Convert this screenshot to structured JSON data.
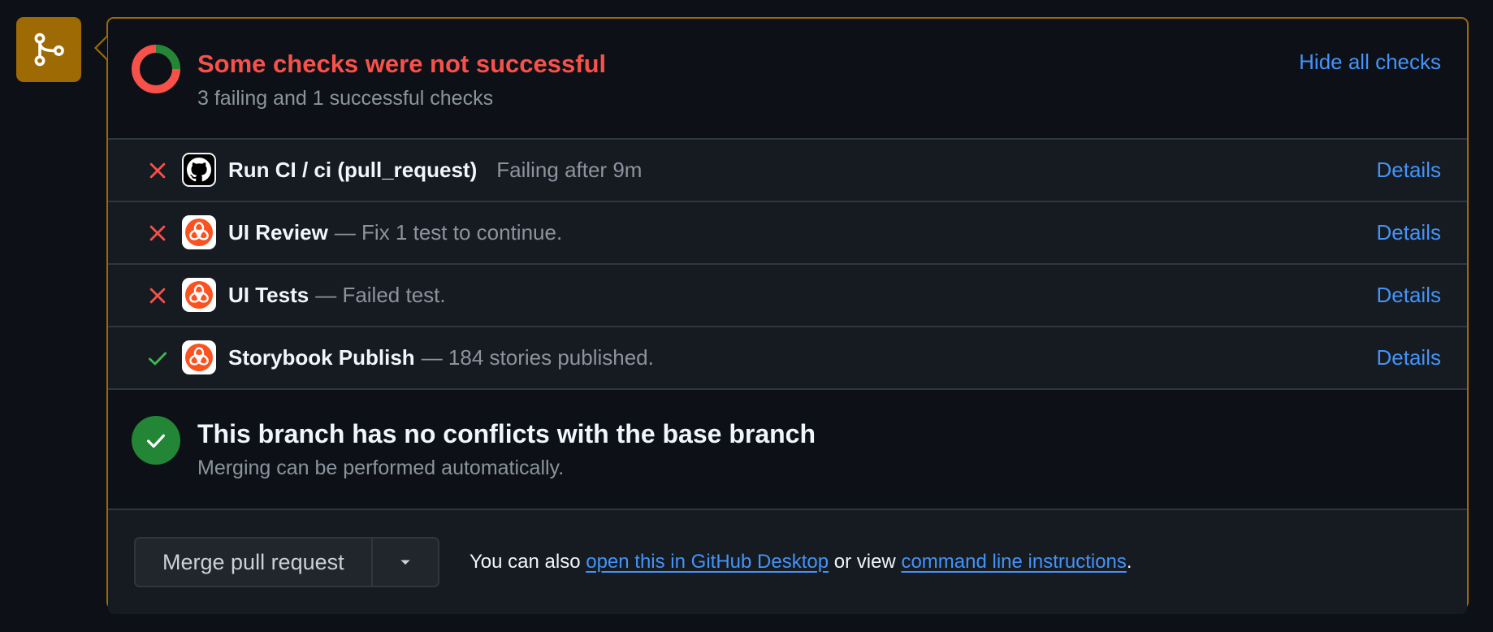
{
  "summary": {
    "title": "Some checks were not successful",
    "subtitle": "3 failing and 1 successful checks",
    "hide_link": "Hide all checks",
    "failing_count": 3,
    "successful_count": 1
  },
  "checks": [
    {
      "status": "failed",
      "icon": "github-icon",
      "name": "Run CI / ci (pull_request)",
      "description": "Failing after 9m",
      "details": "Details"
    },
    {
      "status": "failed",
      "icon": "chromatic-icon",
      "name": "UI Review",
      "description": "— Fix 1 test to continue.",
      "details": "Details"
    },
    {
      "status": "failed",
      "icon": "chromatic-icon",
      "name": "UI Tests",
      "description": "— Failed test.",
      "details": "Details"
    },
    {
      "status": "success",
      "icon": "chromatic-icon",
      "name": "Storybook Publish",
      "description": "— 184 stories published.",
      "details": "Details"
    }
  ],
  "conflicts": {
    "title": "This branch has no conflicts with the base branch",
    "subtitle": "Merging can be performed automatically."
  },
  "merge": {
    "button_label": "Merge pull request",
    "note_prefix": "You can also",
    "desktop_link": "open this in GitHub Desktop",
    "note_middle": "or view",
    "cli_link": "command line instructions",
    "note_suffix": "."
  },
  "colors": {
    "failure": "#f85149",
    "success": "#3fb950",
    "link": "#4493f8",
    "attention": "#9e6a03",
    "chromatic": "#fc521f"
  }
}
